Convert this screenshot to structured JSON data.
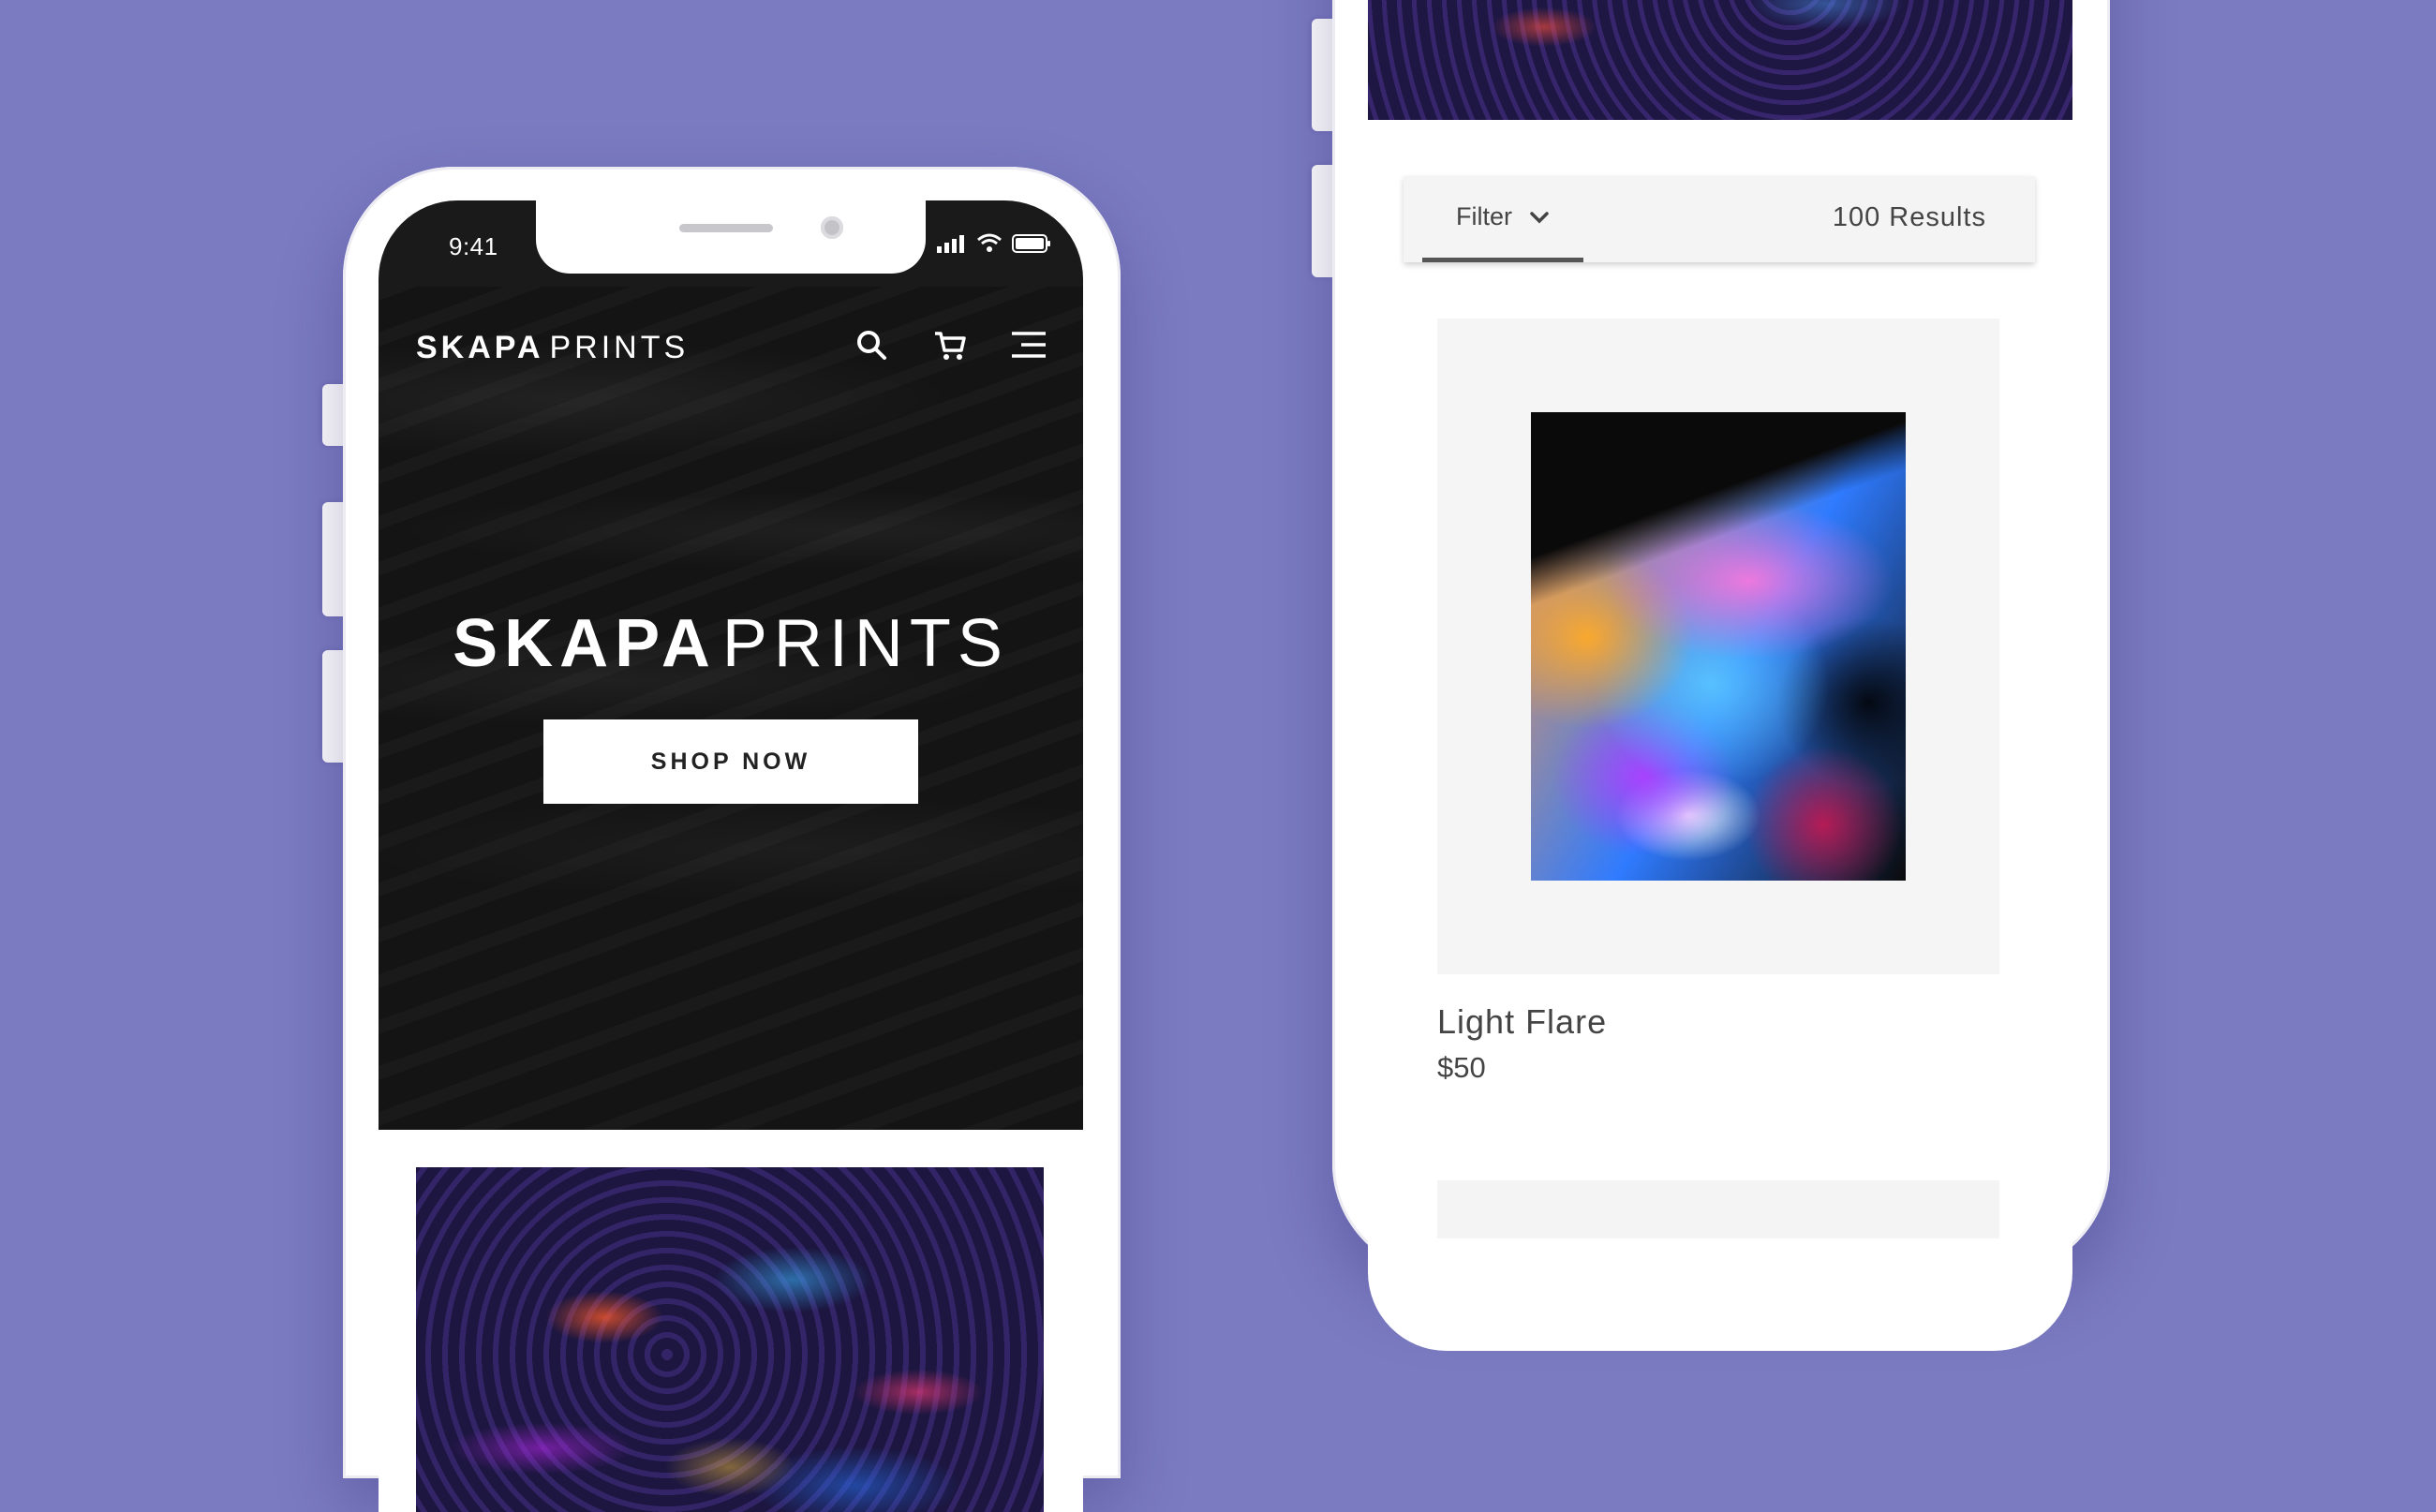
{
  "left_phone": {
    "status_time": "9:41",
    "nav": {
      "logo_bold": "SKAPA",
      "logo_light": "PRINTS",
      "icons": [
        "search-icon",
        "cart-icon",
        "menu-icon"
      ]
    },
    "hero": {
      "title_bold": "SKAPA",
      "title_light": "PRINTS",
      "cta_label": "SHOP NOW"
    }
  },
  "right_phone": {
    "filter": {
      "label": "Filter",
      "results": "100 Results"
    },
    "product": {
      "name": "Light Flare",
      "price": "$50"
    }
  },
  "colors": {
    "background": "#7b7bc2",
    "hero_bg": "#141414",
    "card_bg": "#f5f5f5",
    "text": "#444444"
  }
}
